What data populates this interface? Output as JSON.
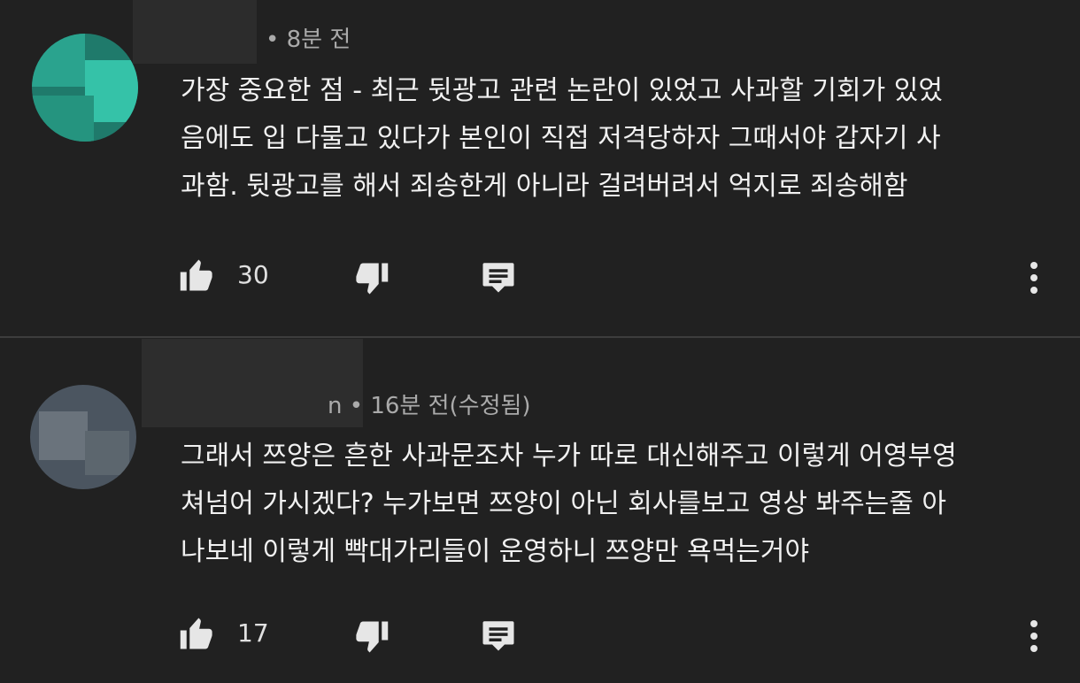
{
  "comments": [
    {
      "meta": "• 8분 전",
      "body_lines": [
        "가장 중요한 점 - 최근 뒷광고 관련 논란이 있었고 사과할 기회가 있었",
        "음에도 입 다물고 있다가 본인이 직접 저격당하자 그때서야 갑자기 사",
        "과함. 뒷광고를 해서 죄송한게 아니라 걸려버려서 억지로 죄송해함"
      ],
      "like_count": "30",
      "icons": {
        "like": "thumbs-up-icon",
        "dislike": "thumbs-down-icon",
        "reply": "comment-icon",
        "more": "more-vertical-icon"
      }
    },
    {
      "meta": "n • 16분 전(수정됨)",
      "body_lines": [
        "그래서 쯔양은 흔한 사과문조차 누가 따로 대신해주고 이렇게 어영부영",
        "쳐넘어 가시겠다? 누가보면 쯔양이 아닌 회사를보고 영상 봐주는줄 아",
        "나보네 이렇게 빡대가리들이 운영하니 쯔양만 욕먹는거야"
      ],
      "like_count": "17",
      "icons": {
        "like": "thumbs-up-icon",
        "dislike": "thumbs-down-icon",
        "reply": "comment-icon",
        "more": "more-vertical-icon"
      }
    }
  ],
  "colors": {
    "background": "#212121",
    "text": "#f1f1f1",
    "meta": "#aaaaaa",
    "icon": "#e6e6e6"
  }
}
